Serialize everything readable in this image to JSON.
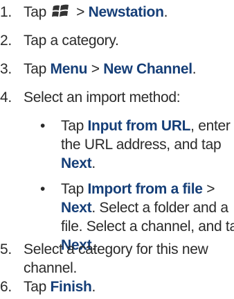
{
  "steps": [
    {
      "num": "1.",
      "pre": "Tap",
      "sep": ">",
      "target": "Newstation",
      "post": "."
    },
    {
      "num": "2.",
      "text": "Tap a category."
    },
    {
      "num": "3.",
      "pre": "Tap",
      "first": "Menu",
      "sep": ">",
      "second": "New Channel",
      "post": "."
    },
    {
      "num": "4.",
      "text": "Select an import method:"
    },
    {
      "num": "5.",
      "line1": "Select a category for this new",
      "line2": "channel."
    },
    {
      "num": "6.",
      "pre": "Tap",
      "target": "Finish",
      "post": "."
    }
  ],
  "bullets": [
    {
      "dot": "•",
      "l1_pre": "Tap",
      "l1_bold": "Input from URL",
      "l1_post": ", enter",
      "l2": "the URL address, and tap",
      "l3_bold": "Next",
      "l3_post": "."
    },
    {
      "dot": "•",
      "l1_pre": "Tap",
      "l1_bold": "Import from a file",
      "l1_post": ">",
      "l2_bold": "Next",
      "l2_post": ". Select a folder and a",
      "l3": "file. Select a channel, and tap",
      "l4_bold": "Next",
      "l4_post": "."
    }
  ],
  "icons": {
    "start": "windows-start-icon"
  },
  "colors": {
    "text": "#2a2a2a",
    "bold": "#163f78"
  }
}
